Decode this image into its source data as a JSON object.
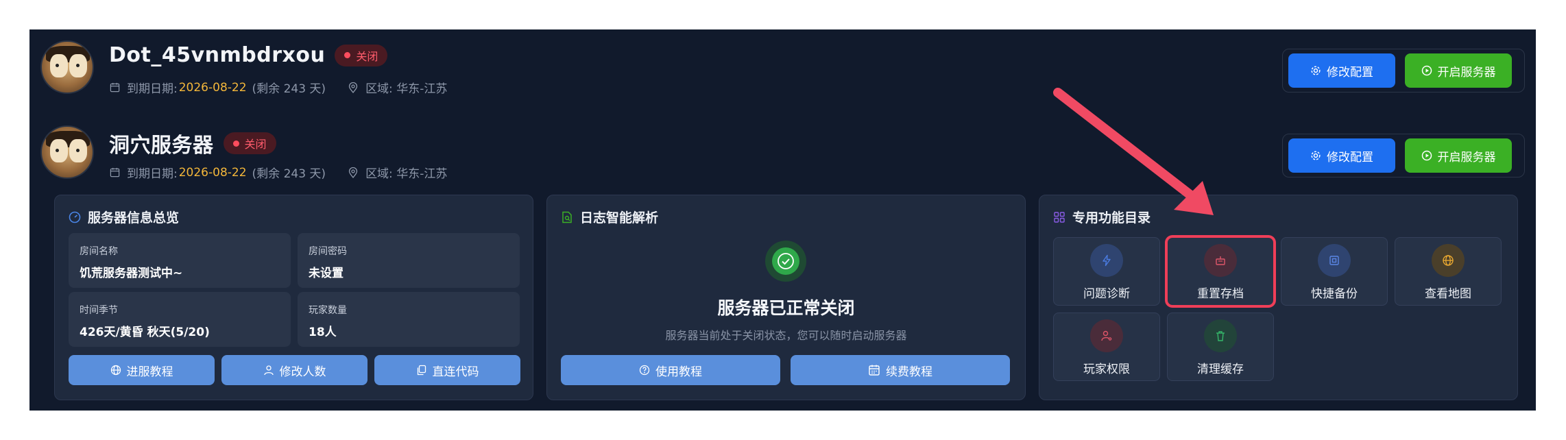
{
  "servers": [
    {
      "name": "Dot_45vnmbdrxou",
      "status": "关闭",
      "expire_label": "到期日期:",
      "expire_date": "2026-08-22",
      "remaining": "(剩余 243 天)",
      "region": "区域: 华东-江苏"
    },
    {
      "name": "洞穴服务器",
      "status": "关闭",
      "expire_label": "到期日期:",
      "expire_date": "2026-08-22",
      "remaining": "(剩余 243 天)",
      "region": "区域: 华东-江苏"
    }
  ],
  "actions": {
    "config": "修改配置",
    "start": "开启服务器"
  },
  "info_panel": {
    "title": "服务器信息总览",
    "cells": [
      {
        "label": "房间名称",
        "value": "饥荒服务器测试中~"
      },
      {
        "label": "房间密码",
        "value": "未设置"
      },
      {
        "label": "时间季节",
        "value": "426天/黄昏 秋天(5/20)"
      },
      {
        "label": "玩家数量",
        "value": "18人"
      }
    ],
    "buttons": [
      "进服教程",
      "修改人数",
      "直连代码"
    ]
  },
  "log_panel": {
    "title": "日志智能解析",
    "heading": "服务器已正常关闭",
    "sub": "服务器当前处于关闭状态，您可以随时启动服务器",
    "buttons": [
      "使用教程",
      "续费教程"
    ]
  },
  "feature_panel": {
    "title": "专用功能目录",
    "items": [
      {
        "label": "问题诊断",
        "icon": "bolt-icon",
        "color": "#4a7be0",
        "bg": "#2f4470"
      },
      {
        "label": "重置存档",
        "icon": "reset-icon",
        "color": "#e0566a",
        "bg": "#4a2c3a"
      },
      {
        "label": "快捷备份",
        "icon": "backup-icon",
        "color": "#5a86e6",
        "bg": "#2f4470"
      },
      {
        "label": "查看地图",
        "icon": "globe-icon",
        "color": "#e6a630",
        "bg": "#4a3f2a"
      },
      {
        "label": "玩家权限",
        "icon": "user-key-icon",
        "color": "#e0566a",
        "bg": "#4a2c3a"
      },
      {
        "label": "清理缓存",
        "icon": "trash-icon",
        "color": "#35b86a",
        "bg": "#22443a"
      }
    ]
  }
}
